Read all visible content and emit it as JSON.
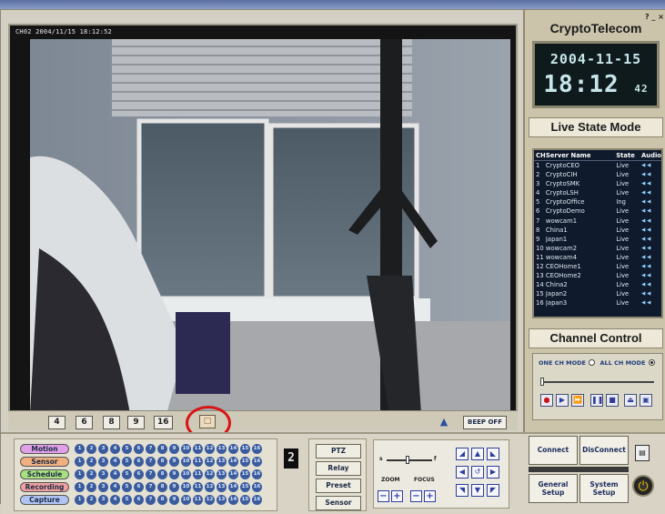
{
  "video": {
    "caption": "CH02  2004/11/15 18:12:52",
    "layout_buttons": [
      "4",
      "6",
      "8",
      "9",
      "16"
    ],
    "snapshot_icon": "snapshot-icon",
    "beep_label": "BEEP OFF"
  },
  "header": {
    "brand": "CryptoTelecom",
    "window_controls": "? _ ×"
  },
  "clock": {
    "date": "2004-11-15",
    "time": "18:12",
    "seconds": "42"
  },
  "live_state": {
    "title": "Live State Mode",
    "columns": [
      "CH",
      "Server Name",
      "State",
      "Audio"
    ],
    "rows": [
      {
        "ch": "1",
        "name": "CryptoCEO",
        "state": "Live"
      },
      {
        "ch": "2",
        "name": "CryptoCIH",
        "state": "Live"
      },
      {
        "ch": "3",
        "name": "CryptoSMK",
        "state": "Live"
      },
      {
        "ch": "4",
        "name": "CryptoLSH",
        "state": "Live"
      },
      {
        "ch": "5",
        "name": "CryptoOffice",
        "state": "Ing"
      },
      {
        "ch": "6",
        "name": "CryptoDemo",
        "state": "Live"
      },
      {
        "ch": "7",
        "name": "wowcam1",
        "state": "Live"
      },
      {
        "ch": "8",
        "name": "China1",
        "state": "Live"
      },
      {
        "ch": "9",
        "name": "Japan1",
        "state": "Live"
      },
      {
        "ch": "10",
        "name": "wowcam2",
        "state": "Live"
      },
      {
        "ch": "11",
        "name": "wowcam4",
        "state": "Live"
      },
      {
        "ch": "12",
        "name": "CEOHome1",
        "state": "Live"
      },
      {
        "ch": "13",
        "name": "CEOHome2",
        "state": "Live"
      },
      {
        "ch": "14",
        "name": "China2",
        "state": "Live"
      },
      {
        "ch": "15",
        "name": "Japan2",
        "state": "Live"
      },
      {
        "ch": "16",
        "name": "Japan3",
        "state": "Live"
      }
    ],
    "audio_glyph": "◀ ◀"
  },
  "channel_control": {
    "title": "Channel Control",
    "one_ch_mode": "ONE CH MODE",
    "all_ch_mode": "ALL CH MODE",
    "selected_mode": "ALL CH MODE",
    "buttons": [
      "record",
      "play",
      "fast-forward",
      "pause",
      "stop",
      "eject",
      "capture"
    ]
  },
  "events": {
    "tags": [
      {
        "label": "Motion",
        "color": "#e0a0e8"
      },
      {
        "label": "Sensor",
        "color": "#f0b080"
      },
      {
        "label": "Schedule",
        "color": "#a8e080"
      },
      {
        "label": "Recording",
        "color": "#f0a0a0"
      },
      {
        "label": "Capture",
        "color": "#b0c4f4"
      }
    ],
    "channel_numbers": [
      "1",
      "2",
      "3",
      "4",
      "5",
      "6",
      "7",
      "8",
      "9",
      "10",
      "11",
      "12",
      "13",
      "14",
      "15",
      "16"
    ]
  },
  "current_channel": "2",
  "side_buttons": [
    "PTZ",
    "Relay",
    "Preset",
    "Sensor"
  ],
  "ptz": {
    "zoom_label": "ZOOM",
    "focus_label": "FOCUS",
    "slider_left": "s",
    "slider_right": "f"
  },
  "actions": {
    "connect": "Connect",
    "disconnect": "DisConnect",
    "general_setup": [
      "General",
      "Setup"
    ],
    "system_setup": [
      "System",
      "Setup"
    ]
  }
}
